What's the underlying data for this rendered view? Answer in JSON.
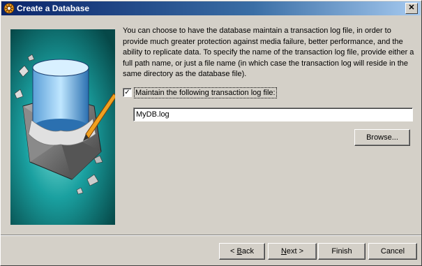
{
  "window": {
    "title": "Create a Database",
    "close_glyph": "✕"
  },
  "main": {
    "description": "You can choose to have the database maintain a transaction log file, in order to provide much greater protection against media failure, better performance, and the ability to replicate data. To specify the name of the transaction log file, provide either a full path name, or just a file name (in which case the transaction log will reside in the same directory as the database file).",
    "checkbox": {
      "label": "Maintain the following transaction log file:",
      "checked": true,
      "check_glyph": "✓"
    },
    "log_file_value": "MyDB.log",
    "browse_label": "Browse..."
  },
  "footer": {
    "back": {
      "pre": "< ",
      "key": "B",
      "post": "ack"
    },
    "next": {
      "pre": "",
      "key": "N",
      "post": "ext >"
    },
    "finish_label": "Finish",
    "cancel_label": "Cancel"
  },
  "icons": {
    "title": "database-wizard-icon",
    "illustration": "database-cylinder-illustration"
  },
  "colors": {
    "titlebar_start": "#0a246a",
    "titlebar_end": "#a6caf0",
    "dialog_face": "#d4d0c8",
    "illustration_bg": "#0f6f6f"
  }
}
